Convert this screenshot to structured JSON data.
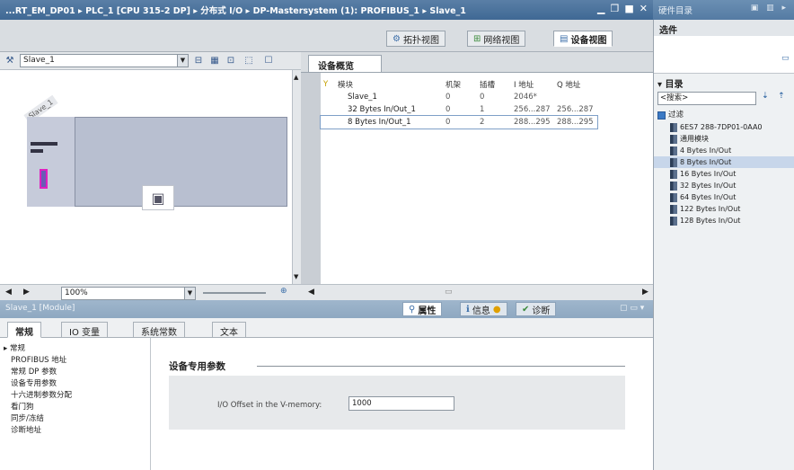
{
  "window": {
    "breadcrumb": "...RT_EM_DP01 ▸ PLC_1 [CPU 315-2 DP] ▸ 分布式 I/O ▸ DP-Mastersystem (1): PROFIBUS_1 ▸ Slave_1",
    "right_title": "硬件目录"
  },
  "view_tabs": [
    {
      "label": "拓扑视图",
      "icon": "topology-icon"
    },
    {
      "label": "网络视图",
      "icon": "network-icon"
    },
    {
      "label": "设备视图",
      "icon": "device-icon",
      "active": true
    }
  ],
  "graphic_toolbar": {
    "device_select": "Slave_1",
    "zoom": "100%"
  },
  "graphic": {
    "device_label": "Slave_1"
  },
  "device_overview": {
    "tab_label": "设备概览",
    "columns": [
      "模块",
      "机架",
      "插槽",
      "I 地址",
      "Q 地址"
    ],
    "rows": [
      {
        "module": "Slave_1",
        "rack": "0",
        "slot": "0",
        "i_addr": "2046*",
        "q_addr": ""
      },
      {
        "module": "32 Bytes In/Out_1",
        "rack": "0",
        "slot": "1",
        "i_addr": "256...287",
        "q_addr": "256...287"
      },
      {
        "module": "8 Bytes In/Out_1",
        "rack": "0",
        "slot": "2",
        "i_addr": "288...295",
        "q_addr": "288...295",
        "selected": true
      }
    ]
  },
  "inspector": {
    "title": "Slave_1 [Module]",
    "tabs": [
      {
        "label": "属性",
        "icon": "properties-icon",
        "active": true
      },
      {
        "label": "信息",
        "icon": "info-icon"
      },
      {
        "label": "诊断",
        "icon": "diagnostics-icon"
      }
    ],
    "sub_tabs": [
      "常规",
      "IO 变量",
      "系统常数",
      "文本"
    ],
    "nav": [
      "常规",
      "PROFIBUS 地址",
      "常规 DP 参数",
      "设备专用参数",
      "十六进制参数分配",
      "看门狗",
      "同步/冻结",
      "诊断地址"
    ],
    "nav_selected": 3,
    "section_title": "设备专用参数",
    "param_label": "I/O Offset in the V-memory:",
    "param_value": "1000"
  },
  "catalog": {
    "options_label": "选件",
    "catalog_label": "目录",
    "search_placeholder": "<搜索>",
    "filter_label": "过滤",
    "items": [
      "6ES7 288-7DP01-0AA0",
      "通用模块",
      "4 Bytes In/Out",
      "8 Bytes In/Out",
      "16 Bytes In/Out",
      "32 Bytes In/Out",
      "64 Bytes In/Out",
      "122 Bytes In/Out",
      "128 Bytes In/Out"
    ],
    "selected_item": 3
  }
}
